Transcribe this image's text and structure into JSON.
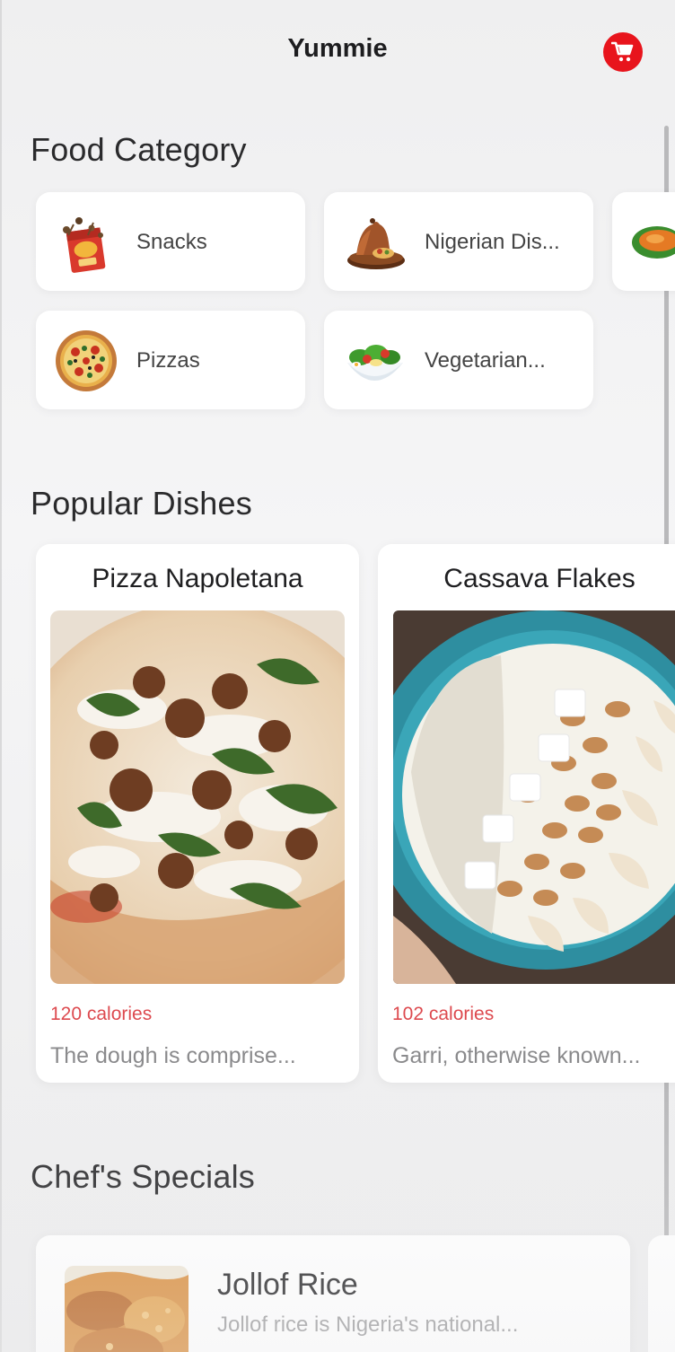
{
  "header": {
    "title": "Yummie",
    "cart_icon": "cart-icon",
    "accent": "#e8141c"
  },
  "sections": {
    "food_category": "Food Category",
    "popular_dishes": "Popular Dishes",
    "chefs_specials": "Chef's Specials"
  },
  "categories": [
    {
      "label": "Snacks",
      "icon": "snack-box-icon"
    },
    {
      "label": "Nigerian Dis...",
      "icon": "tagine-icon"
    },
    {
      "label": "Pizzas",
      "icon": "pizza-icon"
    },
    {
      "label": "Vegetarian...",
      "icon": "salad-icon"
    }
  ],
  "popular": [
    {
      "name": "Pizza Napoletana",
      "calories": "120 calories",
      "description": "The dough is comprise..."
    },
    {
      "name": "Cassava Flakes",
      "calories": "102 calories",
      "description": "Garri, otherwise known..."
    }
  ],
  "specials": [
    {
      "name": "Jollof Rice",
      "description": "Jollof rice is Nigeria's national..."
    }
  ],
  "colors": {
    "calories": "#dd4a4f",
    "background": "#f1f1f2"
  }
}
